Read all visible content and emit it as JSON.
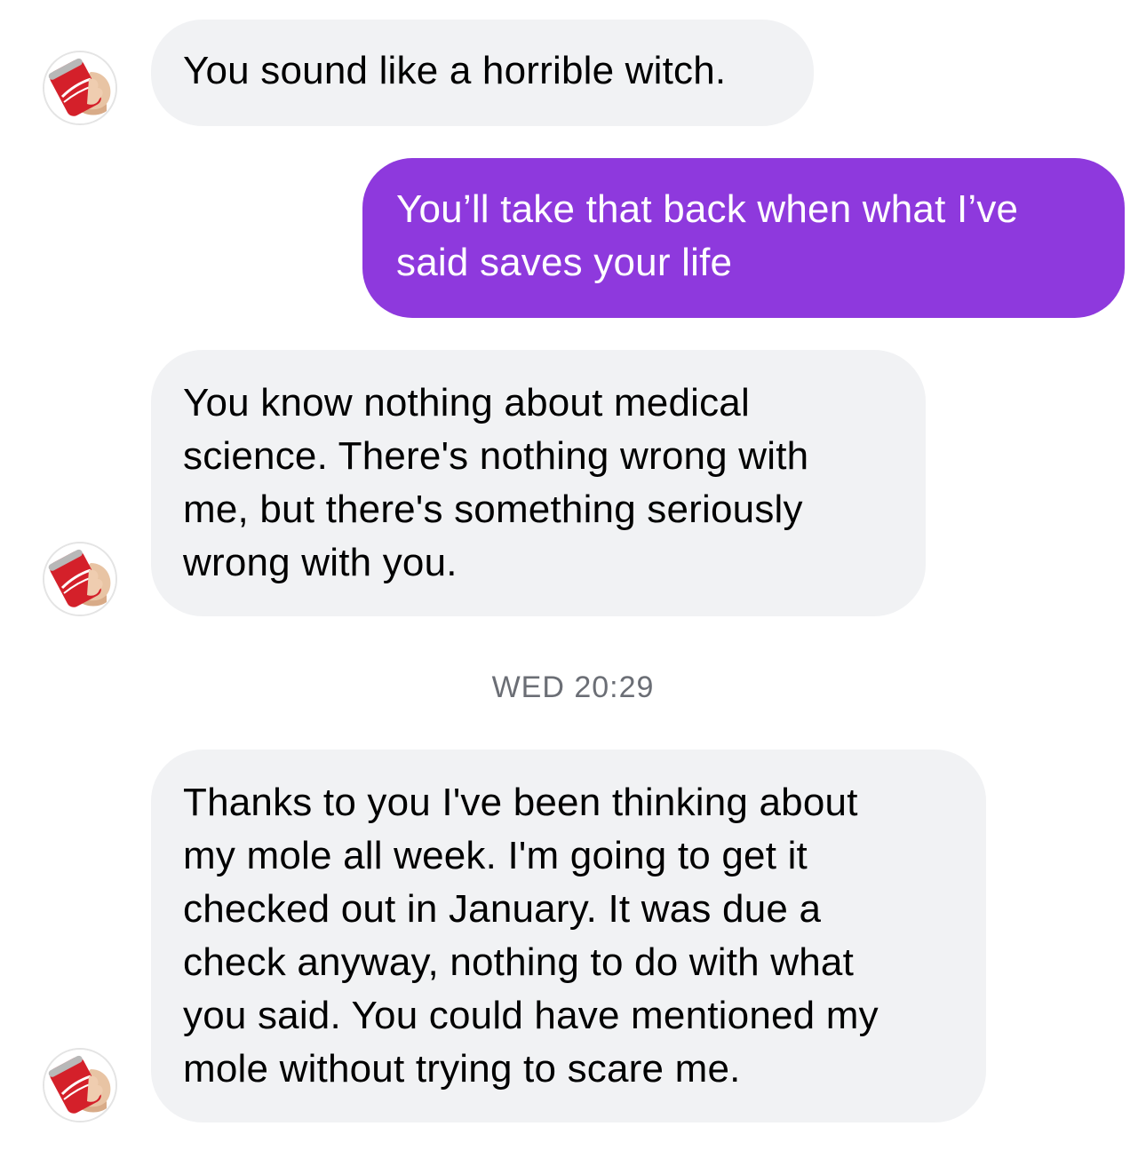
{
  "conversation": {
    "messages": [
      {
        "direction": "incoming",
        "text": "You sound like a horrible witch."
      },
      {
        "direction": "outgoing",
        "text": "You’ll take that back when what I’ve\nsaid saves your life"
      },
      {
        "direction": "incoming",
        "text": "You know nothing about medical\nscience. There's nothing wrong with\nme, but there's something seriously\nwrong with you."
      },
      {
        "direction": "incoming",
        "text": "Thanks to you I've been thinking about\nmy mole all week. I'm going to get it\nchecked out in January. It was due a\ncheck anyway, nothing to do with what\nyou said. You could have mentioned my\nmole without trying to scare me."
      }
    ],
    "timestamp": "WED 20:29",
    "avatar_icon": "cola-can-in-hand-icon"
  },
  "colors": {
    "incoming_bubble": "#f1f2f4",
    "outgoing_bubble": "#8e39dd",
    "timestamp_text": "#6b6e75"
  }
}
